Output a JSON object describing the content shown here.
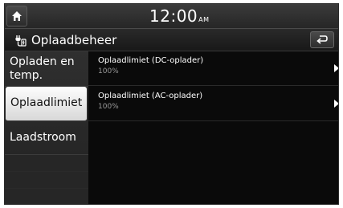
{
  "statusbar": {
    "time": "12:00",
    "ampm": "AM",
    "home_icon": "home-icon"
  },
  "header": {
    "title": "Oplaadbeheer",
    "title_icon": "ev-charging-icon",
    "back_icon": "back-arrow-icon"
  },
  "sidebar": {
    "items": [
      {
        "label": "Opladen en temp.",
        "selected": false
      },
      {
        "label": "Oplaadlimiet",
        "selected": true
      },
      {
        "label": "Laadstroom",
        "selected": false
      }
    ]
  },
  "main": {
    "rows": [
      {
        "label": "Oplaadlimiet (DC-oplader)",
        "value": "100%",
        "icon": "chevron-right-icon"
      },
      {
        "label": "Oplaadlimiet (AC-oplader)",
        "value": "100%",
        "icon": "chevron-right-icon"
      }
    ]
  },
  "colors": {
    "background": "#0b0b0b",
    "selected_item": "#f0f0f0",
    "secondary_text": "#9a9a9a"
  }
}
